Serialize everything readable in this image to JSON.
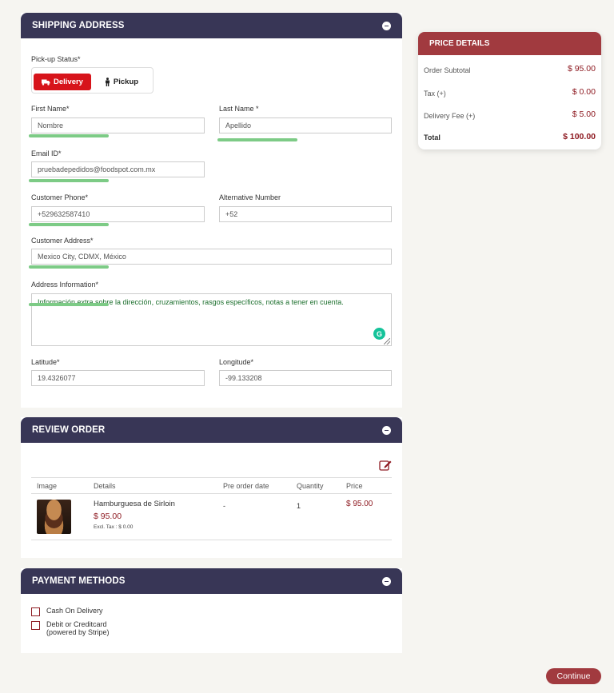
{
  "shipping": {
    "title": "SHIPPING ADDRESS",
    "pickup_status_label": "Pick-up Status*",
    "delivery_label": "Delivery",
    "pickup_label": "Pickup",
    "first_name_label": "First Name*",
    "first_name_value": "Nombre",
    "last_name_label": "Last Name *",
    "last_name_value": "Apellido",
    "email_label": "Email ID*",
    "email_value": "pruebadepedidos@foodspot.com.mx",
    "phone_label": "Customer Phone*",
    "phone_value": "+529632587410",
    "alt_number_label": "Alternative Number",
    "alt_number_value": "+52",
    "address_label": "Customer Address*",
    "address_value": "Mexico City, CDMX, México",
    "address_info_label": "Address Information*",
    "address_info_value": "Información extra sobre la dirección, cruzamientos, rasgos específicos, notas a tener en cuenta.",
    "latitude_label": "Latitude*",
    "latitude_value": "19.4326077",
    "longitude_label": "Longitude*",
    "longitude_value": "-99.133208"
  },
  "review": {
    "title": "REVIEW ORDER",
    "columns": [
      "Image",
      "Details",
      "Pre order date",
      "Quantity",
      "Price"
    ],
    "items": [
      {
        "name": "Hamburguesa de Sirloin",
        "price": "$ 95.00",
        "tax_note": "Excl. Tax : $ 0.00",
        "pre_order_date": "-",
        "quantity": "1",
        "line_price": "$ 95.00"
      }
    ]
  },
  "payment": {
    "title": "PAYMENT METHODS",
    "options": [
      "Cash On Delivery",
      "Debit or Creditcard",
      "(powered by Stripe)"
    ]
  },
  "price_details": {
    "title": "PRICE DETAILS",
    "subtotal_label": "Order Subtotal",
    "subtotal_value": "$ 95.00",
    "tax_label": "Tax (+)",
    "tax_value": "$ 0.00",
    "delivery_label": "Delivery Fee (+)",
    "delivery_value": "$ 5.00",
    "total_label": "Total",
    "total_value": "$ 100.00"
  },
  "continue_label": "Continue",
  "colors": {
    "header": "#383656",
    "accent": "#a13a3f",
    "delivery_active": "#d7141b",
    "underline": "#7dcb86"
  },
  "icons": [
    "collapse-icon",
    "truck-icon",
    "person-icon",
    "edit-icon",
    "grammarly-icon"
  ]
}
